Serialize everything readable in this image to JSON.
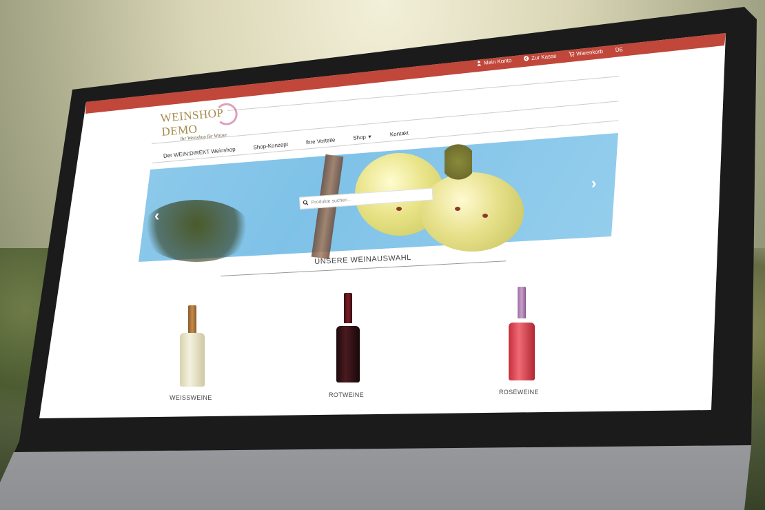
{
  "topnav": {
    "account": "Mein Konto",
    "checkout": "Zur Kasse",
    "cart": "Warenkorb",
    "language": "DE"
  },
  "logo": {
    "title": "WEINSHOP DEMO",
    "subtitle": "Ihr Weinshop für Winzer"
  },
  "mainnav": {
    "items": [
      "Der WEIN:DIREKT Weinshop",
      "Shop-Konzept",
      "Ihre Vorteile",
      "Shop",
      "Kontakt"
    ]
  },
  "hero": {
    "search_placeholder": "Produkte suchen..."
  },
  "section": {
    "title": "UNSERE WEINAUSWAHL"
  },
  "products": [
    {
      "label": "WEISSWEINE"
    },
    {
      "label": "ROTWEINE"
    },
    {
      "label": "ROSÉWEINE"
    }
  ],
  "colors": {
    "topbar": "#c0473a",
    "logo": "#a58a4c"
  }
}
